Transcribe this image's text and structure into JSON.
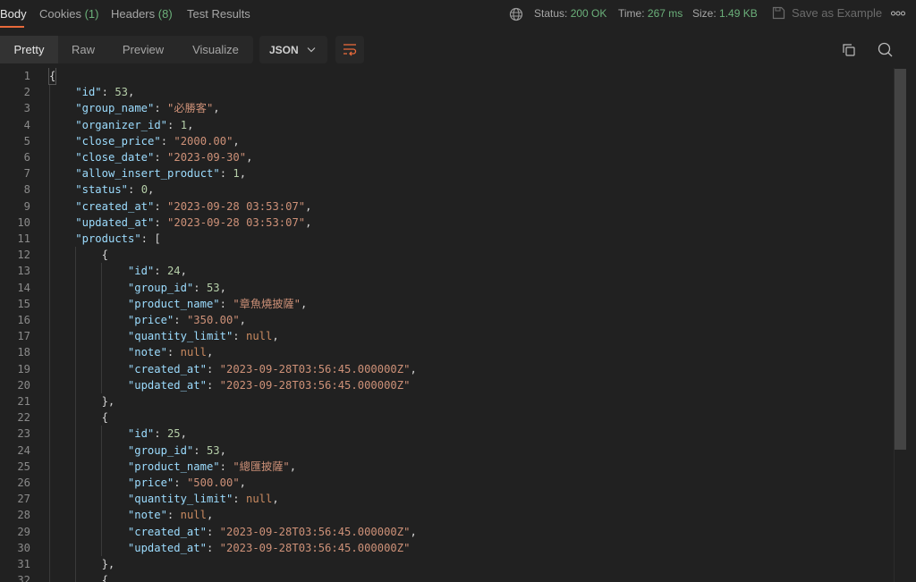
{
  "tabs": [
    {
      "label": "Body",
      "count": ""
    },
    {
      "label": "Cookies",
      "count": "(1)"
    },
    {
      "label": "Headers",
      "count": "(8)"
    },
    {
      "label": "Test Results",
      "count": ""
    }
  ],
  "status": {
    "status_label": "Status:",
    "status_value": "200 OK",
    "time_label": "Time:",
    "time_value": "267 ms",
    "size_label": "Size:",
    "size_value": "1.49 KB",
    "save_label": "Save as Example"
  },
  "views": [
    "Pretty",
    "Raw",
    "Preview",
    "Visualize"
  ],
  "format": "JSON",
  "colors": {
    "accent": "#e8693a",
    "success": "#6bb07a",
    "key": "#9cdcfe",
    "string": "#ce9178",
    "number": "#b5cea8"
  },
  "lines": [
    {
      "indent": 0,
      "tokens": [
        [
          "p",
          "{"
        ]
      ]
    },
    {
      "indent": 1,
      "tokens": [
        [
          "k",
          "\"id\""
        ],
        [
          "p",
          ": "
        ],
        [
          "n",
          "53"
        ],
        [
          "p",
          ","
        ]
      ]
    },
    {
      "indent": 1,
      "tokens": [
        [
          "k",
          "\"group_name\""
        ],
        [
          "p",
          ": "
        ],
        [
          "s",
          "\"必勝客\""
        ],
        [
          "p",
          ","
        ]
      ]
    },
    {
      "indent": 1,
      "tokens": [
        [
          "k",
          "\"organizer_id\""
        ],
        [
          "p",
          ": "
        ],
        [
          "n",
          "1"
        ],
        [
          "p",
          ","
        ]
      ]
    },
    {
      "indent": 1,
      "tokens": [
        [
          "k",
          "\"close_price\""
        ],
        [
          "p",
          ": "
        ],
        [
          "s",
          "\"2000.00\""
        ],
        [
          "p",
          ","
        ]
      ]
    },
    {
      "indent": 1,
      "tokens": [
        [
          "k",
          "\"close_date\""
        ],
        [
          "p",
          ": "
        ],
        [
          "s",
          "\"2023-09-30\""
        ],
        [
          "p",
          ","
        ]
      ]
    },
    {
      "indent": 1,
      "tokens": [
        [
          "k",
          "\"allow_insert_product\""
        ],
        [
          "p",
          ": "
        ],
        [
          "n",
          "1"
        ],
        [
          "p",
          ","
        ]
      ]
    },
    {
      "indent": 1,
      "tokens": [
        [
          "k",
          "\"status\""
        ],
        [
          "p",
          ": "
        ],
        [
          "n",
          "0"
        ],
        [
          "p",
          ","
        ]
      ]
    },
    {
      "indent": 1,
      "tokens": [
        [
          "k",
          "\"created_at\""
        ],
        [
          "p",
          ": "
        ],
        [
          "s",
          "\"2023-09-28 03:53:07\""
        ],
        [
          "p",
          ","
        ]
      ]
    },
    {
      "indent": 1,
      "tokens": [
        [
          "k",
          "\"updated_at\""
        ],
        [
          "p",
          ": "
        ],
        [
          "s",
          "\"2023-09-28 03:53:07\""
        ],
        [
          "p",
          ","
        ]
      ]
    },
    {
      "indent": 1,
      "tokens": [
        [
          "k",
          "\"products\""
        ],
        [
          "p",
          ": ["
        ]
      ]
    },
    {
      "indent": 2,
      "tokens": [
        [
          "p",
          "{"
        ]
      ]
    },
    {
      "indent": 3,
      "tokens": [
        [
          "k",
          "\"id\""
        ],
        [
          "p",
          ": "
        ],
        [
          "n",
          "24"
        ],
        [
          "p",
          ","
        ]
      ]
    },
    {
      "indent": 3,
      "tokens": [
        [
          "k",
          "\"group_id\""
        ],
        [
          "p",
          ": "
        ],
        [
          "n",
          "53"
        ],
        [
          "p",
          ","
        ]
      ]
    },
    {
      "indent": 3,
      "tokens": [
        [
          "k",
          "\"product_name\""
        ],
        [
          "p",
          ": "
        ],
        [
          "s",
          "\"章魚燒披薩\""
        ],
        [
          "p",
          ","
        ]
      ]
    },
    {
      "indent": 3,
      "tokens": [
        [
          "k",
          "\"price\""
        ],
        [
          "p",
          ": "
        ],
        [
          "s",
          "\"350.00\""
        ],
        [
          "p",
          ","
        ]
      ]
    },
    {
      "indent": 3,
      "tokens": [
        [
          "k",
          "\"quantity_limit\""
        ],
        [
          "p",
          ": "
        ],
        [
          "nl",
          "null"
        ],
        [
          "p",
          ","
        ]
      ]
    },
    {
      "indent": 3,
      "tokens": [
        [
          "k",
          "\"note\""
        ],
        [
          "p",
          ": "
        ],
        [
          "nl",
          "null"
        ],
        [
          "p",
          ","
        ]
      ]
    },
    {
      "indent": 3,
      "tokens": [
        [
          "k",
          "\"created_at\""
        ],
        [
          "p",
          ": "
        ],
        [
          "s",
          "\"2023-09-28T03:56:45.000000Z\""
        ],
        [
          "p",
          ","
        ]
      ]
    },
    {
      "indent": 3,
      "tokens": [
        [
          "k",
          "\"updated_at\""
        ],
        [
          "p",
          ": "
        ],
        [
          "s",
          "\"2023-09-28T03:56:45.000000Z\""
        ]
      ]
    },
    {
      "indent": 2,
      "tokens": [
        [
          "p",
          "},"
        ]
      ]
    },
    {
      "indent": 2,
      "tokens": [
        [
          "p",
          "{"
        ]
      ]
    },
    {
      "indent": 3,
      "tokens": [
        [
          "k",
          "\"id\""
        ],
        [
          "p",
          ": "
        ],
        [
          "n",
          "25"
        ],
        [
          "p",
          ","
        ]
      ]
    },
    {
      "indent": 3,
      "tokens": [
        [
          "k",
          "\"group_id\""
        ],
        [
          "p",
          ": "
        ],
        [
          "n",
          "53"
        ],
        [
          "p",
          ","
        ]
      ]
    },
    {
      "indent": 3,
      "tokens": [
        [
          "k",
          "\"product_name\""
        ],
        [
          "p",
          ": "
        ],
        [
          "s",
          "\"總匯披薩\""
        ],
        [
          "p",
          ","
        ]
      ]
    },
    {
      "indent": 3,
      "tokens": [
        [
          "k",
          "\"price\""
        ],
        [
          "p",
          ": "
        ],
        [
          "s",
          "\"500.00\""
        ],
        [
          "p",
          ","
        ]
      ]
    },
    {
      "indent": 3,
      "tokens": [
        [
          "k",
          "\"quantity_limit\""
        ],
        [
          "p",
          ": "
        ],
        [
          "nl",
          "null"
        ],
        [
          "p",
          ","
        ]
      ]
    },
    {
      "indent": 3,
      "tokens": [
        [
          "k",
          "\"note\""
        ],
        [
          "p",
          ": "
        ],
        [
          "nl",
          "null"
        ],
        [
          "p",
          ","
        ]
      ]
    },
    {
      "indent": 3,
      "tokens": [
        [
          "k",
          "\"created_at\""
        ],
        [
          "p",
          ": "
        ],
        [
          "s",
          "\"2023-09-28T03:56:45.000000Z\""
        ],
        [
          "p",
          ","
        ]
      ]
    },
    {
      "indent": 3,
      "tokens": [
        [
          "k",
          "\"updated_at\""
        ],
        [
          "p",
          ": "
        ],
        [
          "s",
          "\"2023-09-28T03:56:45.000000Z\""
        ]
      ]
    },
    {
      "indent": 2,
      "tokens": [
        [
          "p",
          "},"
        ]
      ]
    },
    {
      "indent": 2,
      "tokens": [
        [
          "p",
          "{"
        ]
      ]
    }
  ]
}
